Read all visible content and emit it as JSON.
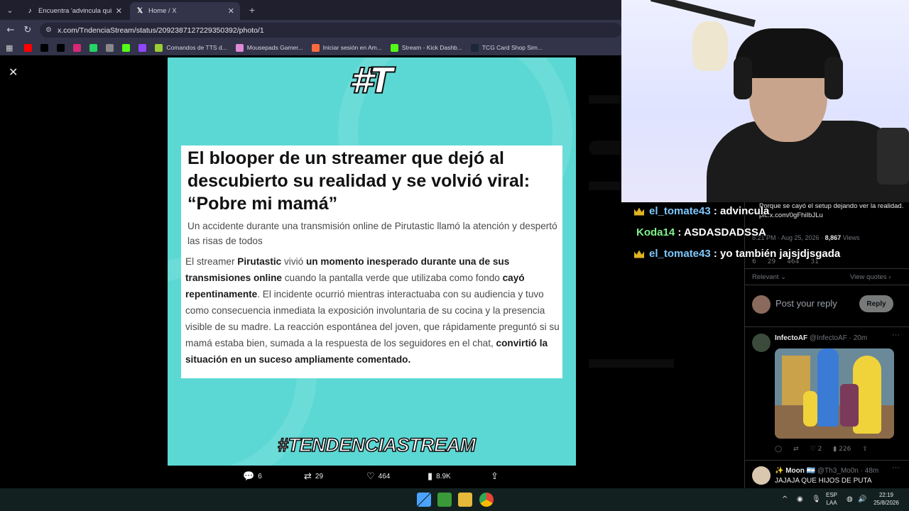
{
  "browser": {
    "tabs": [
      {
        "label": "Encuentra 'advincula quiero ke",
        "icon": "tiktok-icon"
      },
      {
        "label": "Home / X",
        "icon": "x-logo-icon",
        "active": true
      }
    ],
    "url": "x.com/TndenciaStream/status/2092387127229350392/photo/1",
    "bookmarks": [
      {
        "label": "",
        "icon": "youtube-icon",
        "color": "#ff0000"
      },
      {
        "label": "",
        "icon": "x-logo-icon",
        "color": "#000000"
      },
      {
        "label": "",
        "icon": "tiktok-icon",
        "color": "#000000"
      },
      {
        "label": "",
        "icon": "instagram-icon",
        "color": "#d62976"
      },
      {
        "label": "",
        "icon": "whatsapp-icon",
        "color": "#25d366"
      },
      {
        "label": "",
        "icon": "app-icon",
        "color": "#888888"
      },
      {
        "label": "",
        "icon": "kick-icon",
        "color": "#53fc18"
      },
      {
        "label": "",
        "icon": "twitch-icon",
        "color": "#9146ff"
      },
      {
        "label": "Comandos de TTS d...",
        "icon": "tts-icon",
        "color": "#9acd32"
      },
      {
        "label": "Mousepads Gamer...",
        "icon": "shop-icon",
        "color": "#e08ad6"
      },
      {
        "label": "Iniciar sesión en Am...",
        "icon": "amazon-icon",
        "color": "#ff6a3d"
      },
      {
        "label": "Stream - Kick Dashb...",
        "icon": "kick-icon",
        "color": "#53fc18"
      },
      {
        "label": "TCG Card Shop Sim...",
        "icon": "steam-icon",
        "color": "#1b2838"
      }
    ]
  },
  "photo": {
    "logo": "#T",
    "headline": "El blooper de un streamer que dejó al descubierto su realidad y se volvió viral: “Pobre mi mamá”",
    "subhead": "Un accidente durante una transmisión online de Pirutastic llamó la atención y despertó las risas de todos",
    "body": [
      {
        "t": "El streamer ",
        "b": false
      },
      {
        "t": "Pirutastic",
        "b": true
      },
      {
        "t": " vivió ",
        "b": false
      },
      {
        "t": "un momento inesperado durante una de sus transmisiones online",
        "b": true
      },
      {
        "t": " cuando la pantalla verde que utilizaba como fondo ",
        "b": false
      },
      {
        "t": "cayó repentinamente",
        "b": true
      },
      {
        "t": ". El incidente ocurrió mientras interactuaba con su audiencia y tuvo como consecuencia inmediata la exposición involuntaria de su cocina y la presencia visible de su madre. La reacción espontánea del joven, que rápidamente preguntó si su mamá estaba bien, sumada a la respuesta de los seguidores en el chat, ",
        "b": false
      },
      {
        "t": "convirtió la situación en un suceso ampliamente comentado.",
        "b": true
      }
    ],
    "brand": "#TENDENCIASTREAM"
  },
  "photo_actions": {
    "replies": "6",
    "reposts": "29",
    "likes": "464",
    "views": "8.9K"
  },
  "tweet": {
    "text": "Porque se cayó el setup dejando ver la realidad. pic.x.com/0gFhiIbJLu",
    "time": "8:21 PM · Aug 25, 2026 · ",
    "views_count": "8,867",
    "views_label": "Views",
    "stats": {
      "replies": "6",
      "reposts": "29",
      "likes": "464",
      "bookmarks": "31"
    },
    "relevant": "Relevant",
    "view_quotes": "View quotes",
    "reply_placeholder": "Post your reply",
    "reply_button": "Reply"
  },
  "replies": [
    {
      "name": "InfectoAF",
      "handle": "@InfectoAF · 20m",
      "stats": {
        "replies": "",
        "reposts": "",
        "likes": "2",
        "views": "226"
      }
    },
    {
      "name": "✨ Moon 🇦🇷",
      "handle": "@Th3_Mo0n · 48m",
      "text": "JAJAJA QUE HIJOS DE PUTA"
    }
  ],
  "chat": [
    {
      "user": "el_tomate43",
      "msg": ": advincula",
      "badge": "crown"
    },
    {
      "user": "Koda14",
      "msg": ": ASDASDADSSA",
      "badge": ""
    },
    {
      "user": "el_tomate43",
      "msg": ": yo también jajsjdjsgada",
      "badge": "crown"
    }
  ],
  "taskbar": {
    "lang": "ESP",
    "lang2": "LAA",
    "time": "22:19",
    "date": "25/8/2026"
  },
  "colors": {
    "photo_bg": "#5cd8d4",
    "chrome_bg": "#33334a",
    "x_blue": "#1d9bf0"
  }
}
